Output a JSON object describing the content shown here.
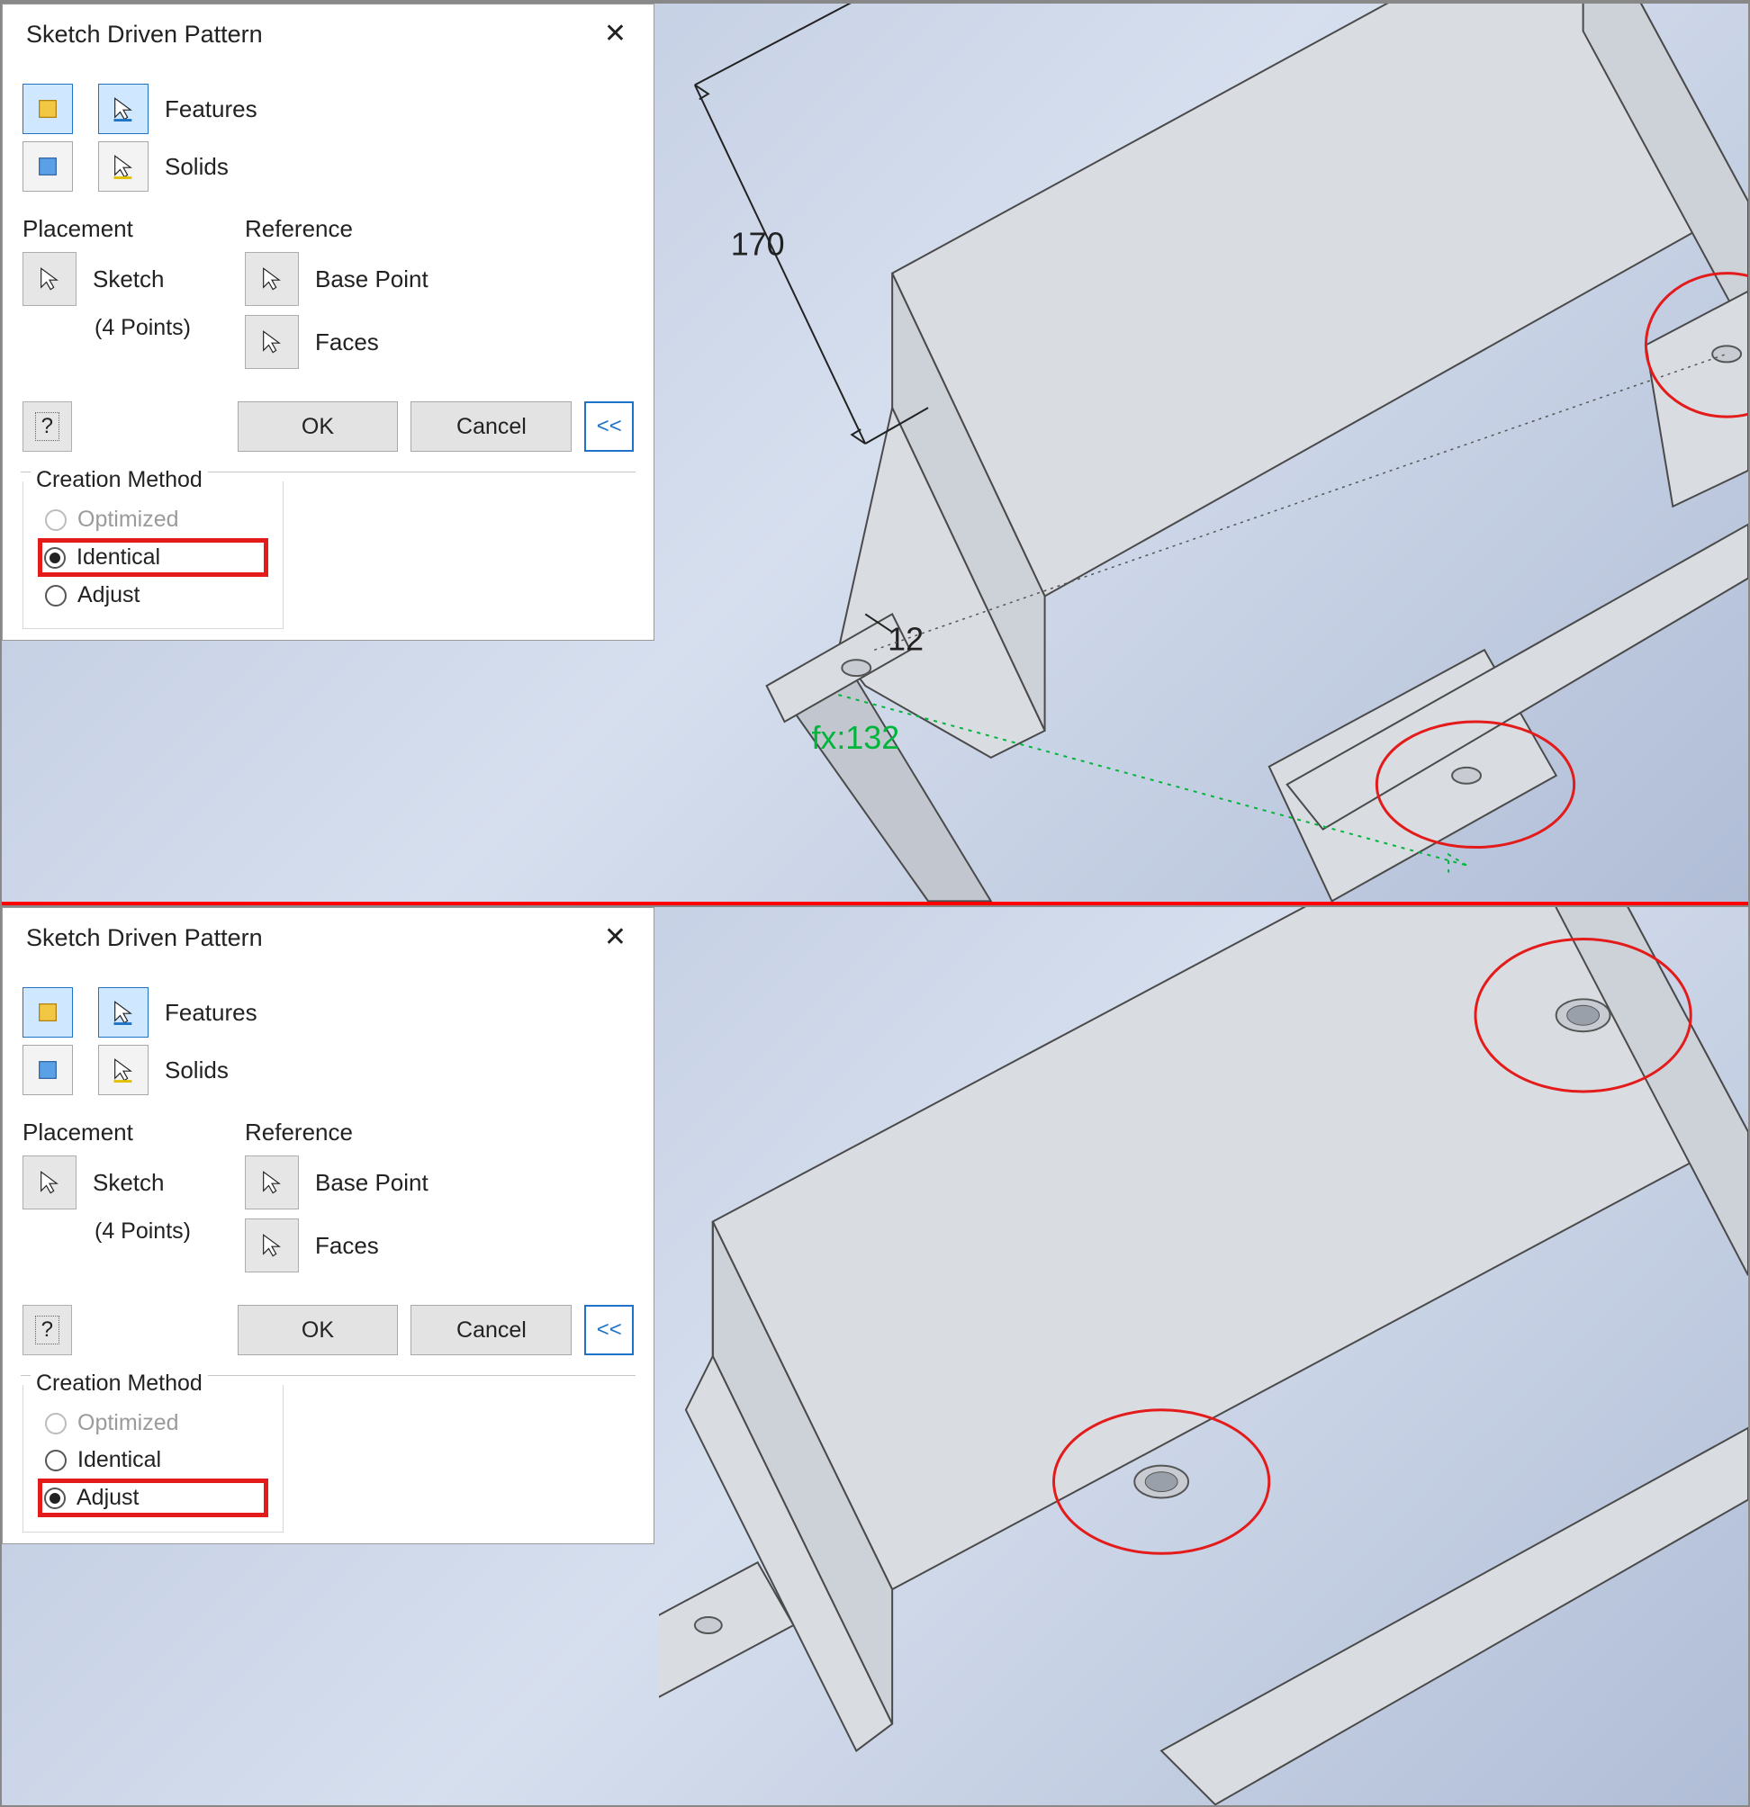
{
  "dialog": {
    "title": "Sketch Driven Pattern",
    "close_icon_name": "close-icon",
    "features_label": "Features",
    "solids_label": "Solids",
    "placement_title": "Placement",
    "placement_sketch": "Sketch",
    "placement_points": "(4 Points)",
    "reference_title": "Reference",
    "reference_base": "Base Point",
    "reference_faces": "Faces",
    "help_label": "?",
    "ok_label": "OK",
    "cancel_label": "Cancel",
    "expand_label": "<<",
    "creation_title": "Creation Method",
    "opt_optimized": "Optimized",
    "opt_identical": "Identical",
    "opt_adjust": "Adjust"
  },
  "viewport1": {
    "dim1": "170",
    "dim2": "12",
    "dim3": "fx:132"
  }
}
